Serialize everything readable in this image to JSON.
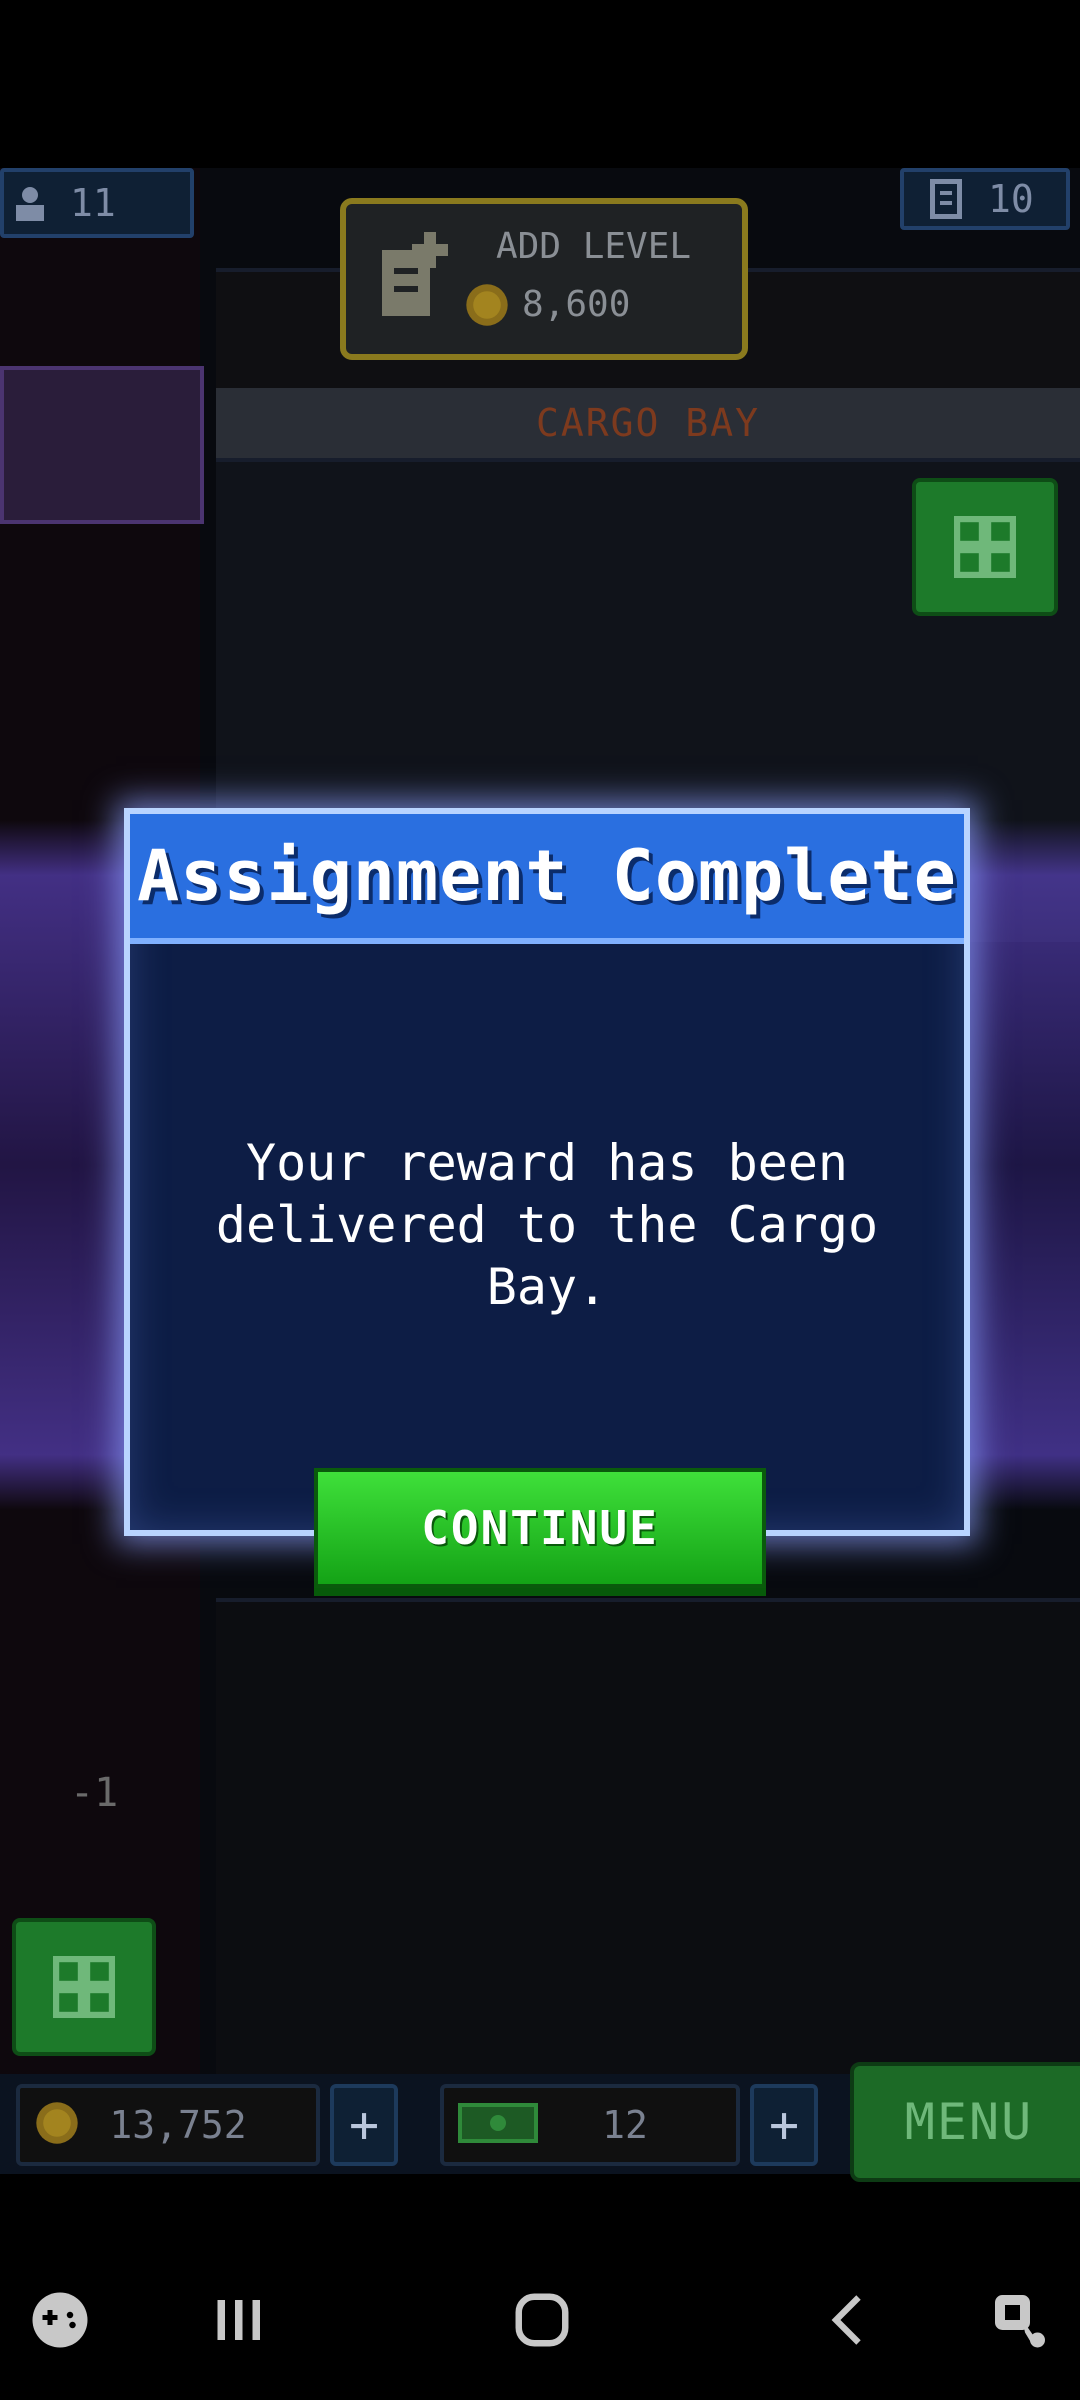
{
  "hud": {
    "population_count": "11",
    "floor_count": "10",
    "add_level_label": "ADD LEVEL",
    "add_level_cost": "8,600",
    "floor_name": "CARGO BAY",
    "elevator_level": "-1"
  },
  "dialog": {
    "title": "Assignment Complete",
    "message": "Your reward has been delivered to the Cargo Bay.",
    "continue_label": "CONTINUE"
  },
  "bottom_bar": {
    "coins": "13,752",
    "bux": "12",
    "menu_label": "MENU"
  },
  "colors": {
    "dialog_header": "#2a6fe0",
    "dialog_body": "#0d1d45",
    "continue_green": "#22c21f",
    "glow_purple": "#6e50e6"
  },
  "icons": {
    "population": "person-icon",
    "floors": "building-icon",
    "add_level": "add-floor-icon",
    "coin": "coin-icon",
    "bux": "bux-icon",
    "grid": "grid-icon",
    "nav_game": "game-launcher-icon",
    "nav_recents": "recents-icon",
    "nav_home": "home-icon",
    "nav_back": "back-icon",
    "nav_screenshot": "assistant-icon"
  }
}
